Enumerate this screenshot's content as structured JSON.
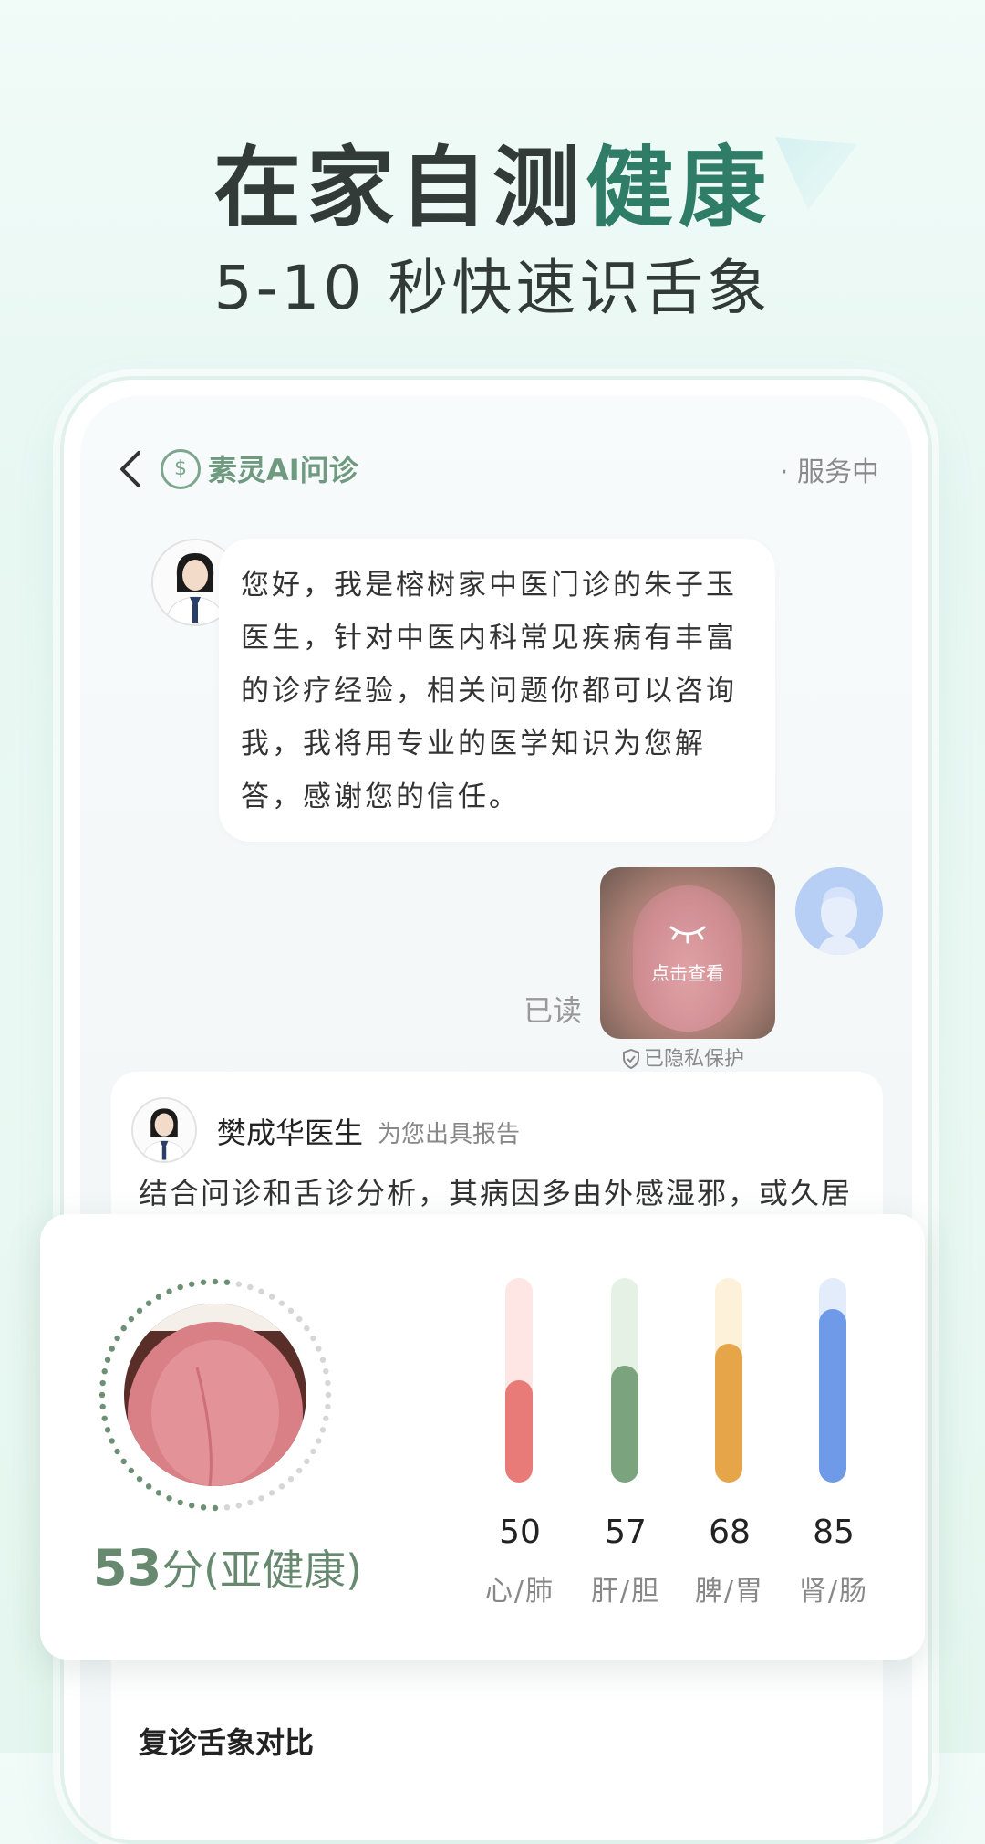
{
  "hero": {
    "title_plain": "在家自测",
    "title_accent": "健康",
    "subtitle": "5-10 秒快速识舌象"
  },
  "app": {
    "name": "素灵AI问诊",
    "status": "· 服务中",
    "logo_icon": "suling-logo-icon"
  },
  "chat": {
    "doctor_message": "您好，我是榕树家中医门诊的朱子玉医生，针对中医内科常见疾病有丰富的诊疗经验，相关问题你都可以咨询我，我将用专业的医学知识为您解答，感谢您的信任。",
    "image_hint": "点击查看",
    "read_status": "已读",
    "privacy_note": "已隐私保护"
  },
  "report": {
    "doctor_name": "樊成华医生",
    "tag": "为您出具报告",
    "text": "结合问诊和舌诊分析，其病因多由外感湿邪，或久居",
    "followup_title": "复诊舌象对比"
  },
  "score": {
    "value": "53",
    "unit": "分",
    "status": "(亚健康)",
    "ring_progress": 0.53
  },
  "organs": [
    {
      "value": "50",
      "label": "心/肺",
      "fraction": 0.5,
      "color": "#e87a78",
      "track": "#fde6e4"
    },
    {
      "value": "57",
      "label": "肝/胆",
      "fraction": 0.57,
      "color": "#7ba37d",
      "track": "#e6f1e6"
    },
    {
      "value": "68",
      "label": "脾/胃",
      "fraction": 0.68,
      "color": "#e6a548",
      "track": "#fdf1d9"
    },
    {
      "value": "85",
      "label": "肾/肠",
      "fraction": 0.85,
      "color": "#6f9ae8",
      "track": "#e3ecfb"
    }
  ]
}
